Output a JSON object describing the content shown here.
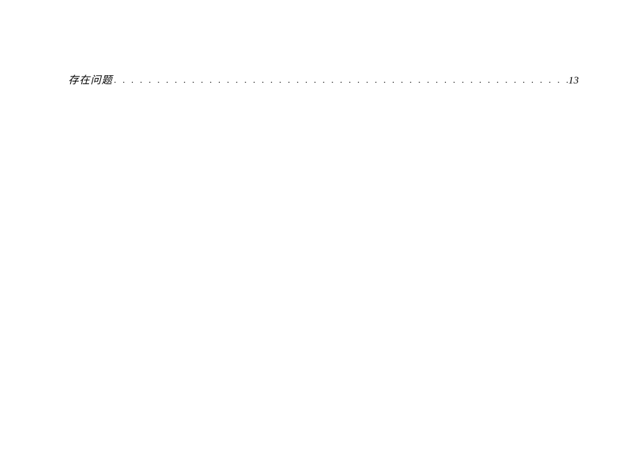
{
  "toc": {
    "entries": [
      {
        "title": "存在问题",
        "leader": ". . . . . . . . . . . . . . . . . . . . . . . . . . . . . . . . . . . . . . . . . . . . . . . . . . . . . . . . . . . . . . . . . . . . . . . . . . . . . . . . . . . . . . . . . . . . . . . . . . . . . . . . . . . . . . . . . . . . . . . .",
        "page": "13"
      }
    ]
  }
}
